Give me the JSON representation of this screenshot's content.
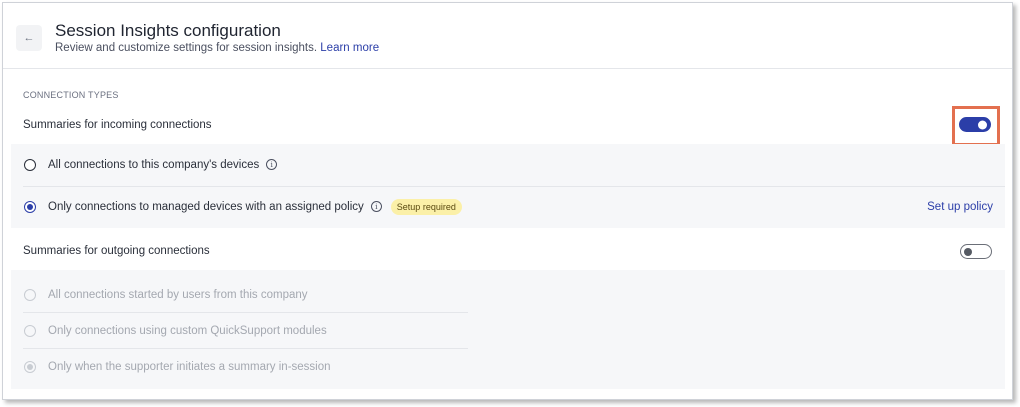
{
  "header": {
    "back_icon": "arrow-left-icon",
    "title": "Session Insights configuration",
    "subtitle": "Review and customize settings for session insights.",
    "learn_more": "Learn more"
  },
  "section": {
    "label": "CONNECTION TYPES"
  },
  "incoming": {
    "heading": "Summaries for incoming connections",
    "toggle_on": true,
    "options": [
      {
        "label": "All connections to this company's devices",
        "checked": false,
        "info": true
      },
      {
        "label": "Only connections to managed devices with an assigned policy",
        "checked": true,
        "info": true,
        "badge": "Setup required",
        "action": "Set up policy"
      }
    ]
  },
  "outgoing": {
    "heading": "Summaries for outgoing connections",
    "toggle_on": false,
    "options": [
      {
        "label": "All connections started by users from this company",
        "checked": false,
        "disabled": true
      },
      {
        "label": "Only connections using custom QuickSupport modules",
        "checked": false,
        "disabled": true
      },
      {
        "label": "Only when the supporter initiates a summary in-session",
        "checked": true,
        "disabled": true
      }
    ]
  },
  "colors": {
    "accent": "#2b3ea8",
    "highlight": "#e3704f",
    "badge_bg": "#fbf0a8"
  }
}
